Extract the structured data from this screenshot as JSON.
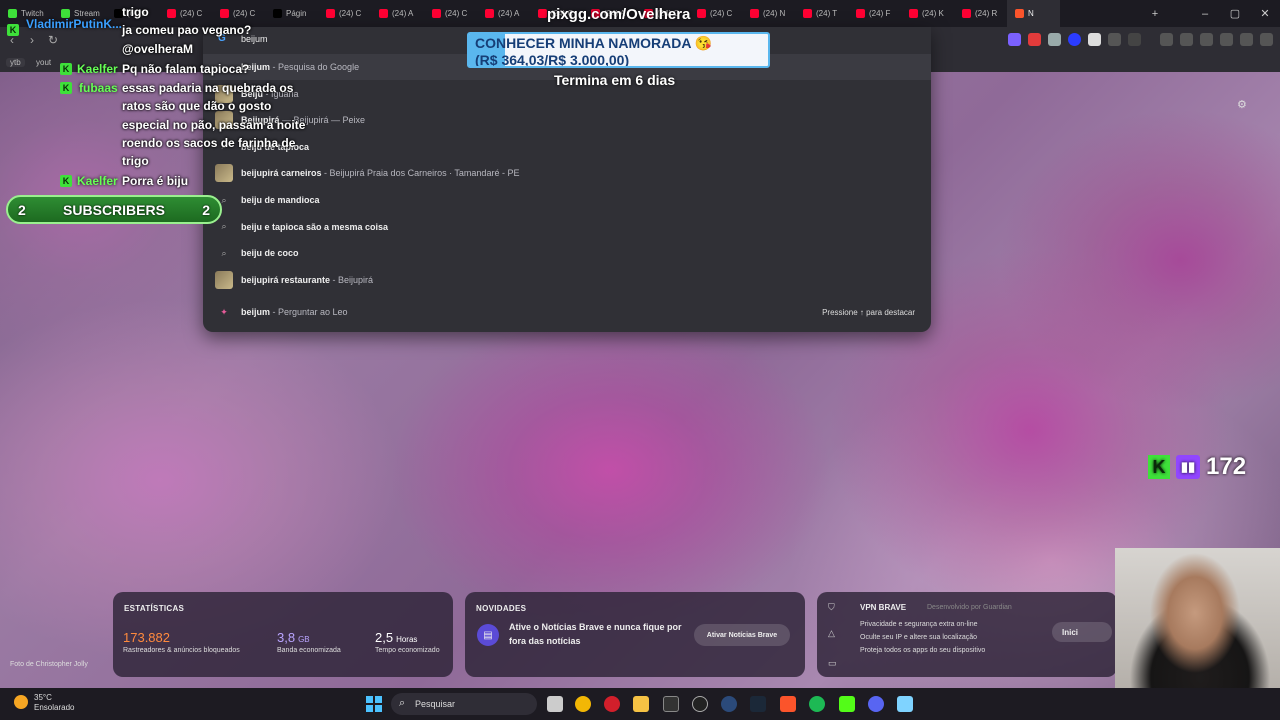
{
  "tabs": [
    {
      "label": "Twitch",
      "color": "#3ee13a"
    },
    {
      "label": "Stream",
      "color": "#3ee13a"
    },
    {
      "label": "(6) no",
      "color": "#000000"
    },
    {
      "label": "(24) C",
      "color": "#ff0033"
    },
    {
      "label": "(24) C",
      "color": "#ff0033"
    },
    {
      "label": "Págin",
      "color": "#000000"
    },
    {
      "label": "(24) C",
      "color": "#ff0033"
    },
    {
      "label": "(24) A",
      "color": "#ff0033"
    },
    {
      "label": "(24) C",
      "color": "#ff0033"
    },
    {
      "label": "(24) A",
      "color": "#ff0033"
    },
    {
      "label": "(24) C",
      "color": "#ff0033"
    },
    {
      "label": "(24) A",
      "color": "#ff0033"
    },
    {
      "label": "(24) C",
      "color": "#ff0033"
    },
    {
      "label": "(24) C",
      "color": "#ff0033"
    },
    {
      "label": "(24) N",
      "color": "#ff0033"
    },
    {
      "label": "(24) T",
      "color": "#ff0033"
    },
    {
      "label": "(24) F",
      "color": "#ff0033"
    },
    {
      "label": "(24) K",
      "color": "#ff0033"
    },
    {
      "label": "(24) R",
      "color": "#ff0033"
    },
    {
      "label": "N",
      "color": "#fb542b"
    }
  ],
  "bookmarks": [
    "ytb",
    "yout"
  ],
  "omnibox": {
    "query": "beijum",
    "suggestions": [
      {
        "bold": "beijum",
        "desc": " - Pesquisa do Google",
        "icon": "search-icon"
      },
      {
        "bold": "Beiju",
        "desc": " - Iguaria",
        "icon": "thumbnail"
      },
      {
        "bold": "Beijupirá",
        "desc": " — Beijupirá — Peixe",
        "icon": "thumbnail"
      },
      {
        "bold": "beiju de tapioca",
        "desc": "",
        "icon": "search-icon"
      },
      {
        "bold": "beijupirá carneiros",
        "desc": " - Beijupirá Praia dos Carneiros · Tamandaré - PE",
        "icon": "thumbnail"
      },
      {
        "bold": "beiju de mandioca",
        "desc": "",
        "icon": "search-icon"
      },
      {
        "bold": "beiju e tapioca são a mesma coisa",
        "desc": "",
        "icon": "search-icon"
      },
      {
        "bold": "beiju de coco",
        "desc": "",
        "icon": "search-icon"
      },
      {
        "bold": "beijupirá restaurante",
        "desc": " - Beijupirá",
        "icon": "thumbnail"
      },
      {
        "bold": "beijum",
        "desc": " - Perguntar ao Leo",
        "icon": "leo-icon"
      }
    ],
    "hint": "Pressione ↑ para destacar"
  },
  "chat": {
    "lines": [
      {
        "name": "",
        "text": "trigo"
      },
      {
        "name": "VladimirPutinK...",
        "text": "ja comeu pao vegano?"
      },
      {
        "name": "",
        "text": "@ovelheraM"
      },
      {
        "name": "Kaelfer",
        "text": "Pq não falam tapioca?"
      },
      {
        "name": "fubaas",
        "text": "essas padaria na quebrada os"
      },
      {
        "name": "",
        "text": "ratos são que dão o gosto"
      },
      {
        "name": "",
        "text": "especial no pão, passam a noite"
      },
      {
        "name": "",
        "text": "roendo os sacos de farinha de"
      },
      {
        "name": "",
        "text": "trigo"
      },
      {
        "name": "Kaelfer",
        "text": "Porra é biju"
      }
    ]
  },
  "subscribers": {
    "left": "2",
    "label": "SUBSCRIBERS",
    "right": "2"
  },
  "stream": {
    "pix": "pixgg.com/Ovelhera",
    "goal_title": "CONHECER MINHA NAMORADA 😘",
    "goal_amount": "(R$ 364,03/R$ 3.000,00)",
    "goal_progress": 0.121,
    "goal_end": "Termina em 6 dias",
    "viewers": "172"
  },
  "stats": {
    "title": "ESTATÍSTICAS",
    "items": [
      {
        "value": "173.882",
        "unit": "",
        "label": "Rastreadores & anúncios bloqueados",
        "color": "#ff8a3d"
      },
      {
        "value": "3,8",
        "unit": "GB",
        "label": "Banda economizada",
        "color": "#b9a4ff"
      },
      {
        "value": "2,5",
        "unit": "Horas",
        "label": "Tempo economizado",
        "color": "#ffffff"
      }
    ]
  },
  "news": {
    "title": "NOVIDADES",
    "text1": "Ative o Notícias Brave e nunca fique por",
    "text2": "fora das notícias",
    "button": "Ativar Notícias Brave"
  },
  "vpn": {
    "title": "VPN BRAVE",
    "by": "Desenvolvido por  Guardian",
    "lines": [
      "Privacidade e segurança extra on-line",
      "Oculte seu IP e altere sua localização",
      "Proteja todos os apps do seu dispositivo"
    ],
    "button": "Inici"
  },
  "photo_credit": "Foto de Christopher Jolly",
  "taskbar": {
    "temp": "35°C",
    "weather": "Ensolarado",
    "search": "Pesquisar"
  }
}
